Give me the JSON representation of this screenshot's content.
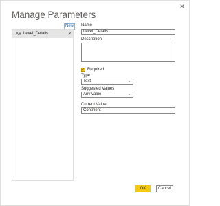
{
  "dialog": {
    "title": "Manage Parameters",
    "close_glyph": "✕",
    "new_label": "New",
    "parameters": [
      {
        "name": "Level_Details",
        "icon": "parameter-icon",
        "remove_glyph": "✕"
      }
    ]
  },
  "form": {
    "name_label": "Name",
    "name_value": "Level_Details",
    "description_label": "Description",
    "description_value": "",
    "required_label": "Required",
    "required_checked": true,
    "type_label": "Type",
    "type_value": "Text",
    "suggested_label": "Suggested Values",
    "suggested_value": "Any value",
    "current_label": "Current Value",
    "current_value": "Continent"
  },
  "buttons": {
    "ok_label": "OK",
    "cancel_label": "Cancel"
  },
  "colors": {
    "accent": "#f2c811",
    "selected_item": "#e5e5e5",
    "link": "#1f5fa8"
  }
}
